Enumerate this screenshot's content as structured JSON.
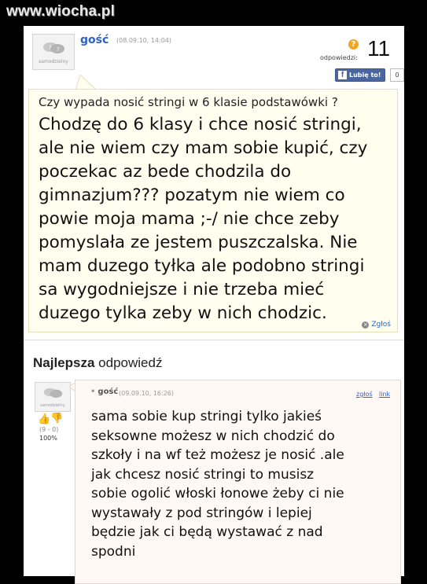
{
  "watermark": "www.wiocha.pl",
  "question": {
    "author": "gość",
    "date": "(08.09.10, 14:04)",
    "avatar_label": "samodzielny",
    "answers_label": "odpowiedzi:",
    "answers_count": "11",
    "like_label": "Lubię to!",
    "like_count": "0",
    "title": "Czy wypada nosić stringi w 6 klasie podstawówki ?",
    "body": "Chodzę do 6 klasy i chce nosić stringi,\nale nie wiem czy mam sobie kupić, czy\npoczekac az bede chodzila do\ngimnazjum??? pozatym nie wiem co\npowie moja mama ;-/ nie chce zeby\npomyslała ze jestem puszczalska. Nie\nmam duzego tyłka ale podobno stringi\nsa wygodniejsze i nie trzeba mieć\nduzego tylka zeby w nich chodzic.",
    "report_label": "Zgłoś"
  },
  "best_answer": {
    "heading_bold": "Najlepsza",
    "heading_rest": " odpowiedź",
    "avatar_label": "samodzielny",
    "vote_stat": "(9 - 0)",
    "vote_percent": "100%",
    "author": "gość",
    "date": "(09.09.10, 16:26)",
    "report_label": "zgłoś",
    "link_label": "link",
    "body": "sama sobie kup stringi tylko jakieś\nseksowne możesz w nich chodzić do\nszkoły i na wf też możesz je nosić .ale\njak chcesz nosić stringi to musisz\nsobie ogolić włoski łonowe żeby ci nie\nwystawały z pod stringów i lepiej\nbędzie jak ci będą wystawać z nad\nspodni"
  },
  "colors": {
    "link_blue": "#2d62c7",
    "question_bg": "#fffff0",
    "answer_bg": "#fff8f5",
    "facebook_blue": "#4a66a0",
    "answers_badge": "#f1a521"
  }
}
